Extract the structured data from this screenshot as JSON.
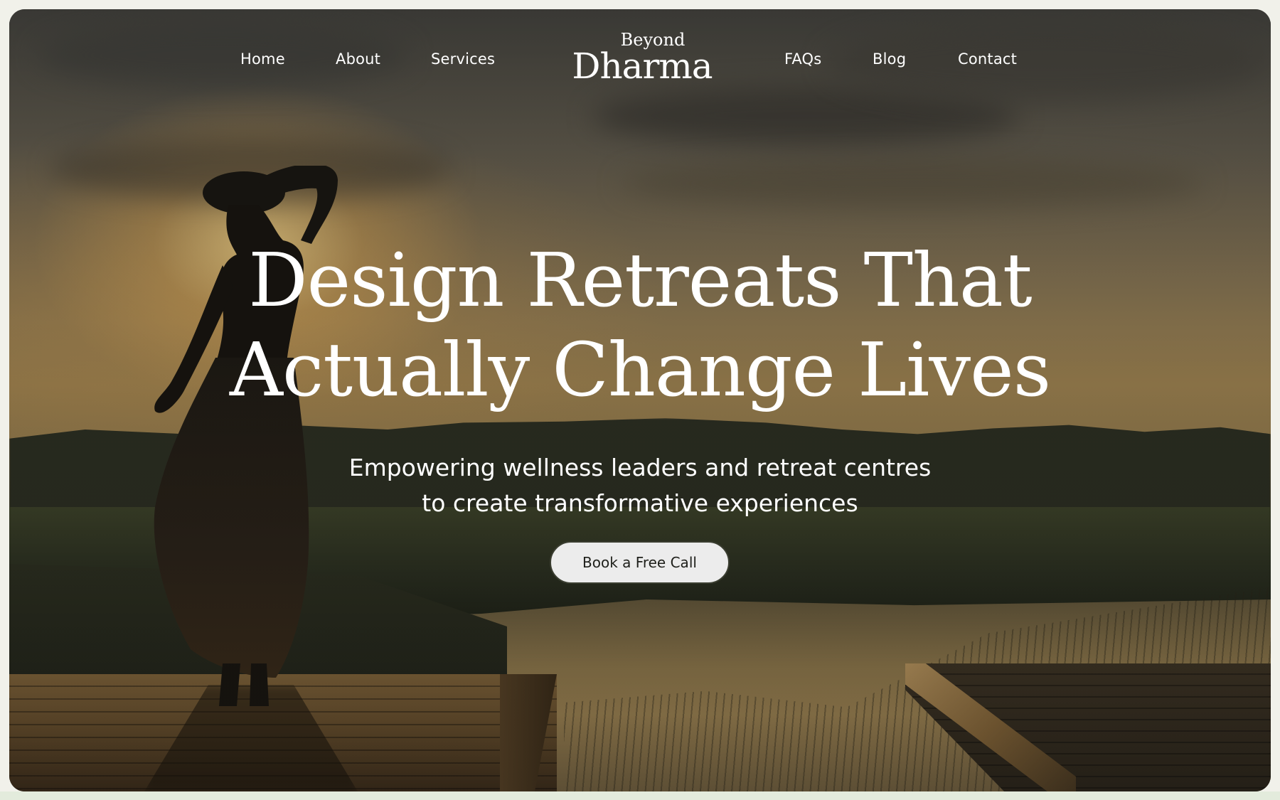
{
  "nav": {
    "left_items": [
      {
        "label": "Home"
      },
      {
        "label": "About"
      },
      {
        "label": "Services"
      }
    ],
    "right_items": [
      {
        "label": "FAQs"
      },
      {
        "label": "Blog"
      },
      {
        "label": "Contact"
      }
    ]
  },
  "logo": {
    "top": "Beyond",
    "main": "Dharma"
  },
  "hero": {
    "title_line1": "Design Retreats That",
    "title_line2": "Actually Change Lives",
    "subtitle_line1": "Empowering wellness leaders and retreat centres",
    "subtitle_line2": "to create transformative experiences",
    "cta_label": "Book a Free Call"
  },
  "colors": {
    "text": "#ffffff",
    "cta_bg": "#ececec",
    "cta_border": "#3a3d30",
    "page_bg": "#f1f1ea",
    "bottom_strip": "#e3ebdc"
  }
}
